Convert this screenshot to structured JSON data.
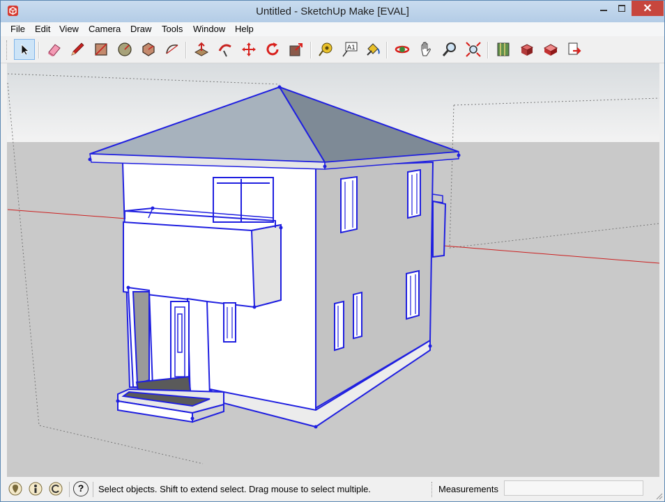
{
  "window": {
    "title": "Untitled - SketchUp Make [EVAL]",
    "close_symbol": "✕"
  },
  "menu": [
    "File",
    "Edit",
    "View",
    "Camera",
    "Draw",
    "Tools",
    "Window",
    "Help"
  ],
  "toolbar": {
    "tools": [
      "select-tool",
      "eraser-tool",
      "line-tool",
      "rectangle-tool",
      "circle-tool",
      "polygon-tool",
      "arc-tool",
      "push-pull-tool",
      "follow-me-tool",
      "move-tool",
      "rotate-tool",
      "scale-tool",
      "tape-measure-tool",
      "text-tool",
      "paint-bucket-tool",
      "orbit-tool",
      "pan-tool",
      "zoom-tool",
      "zoom-extents-tool",
      "model-info-tool",
      "components-tool",
      "warehouse-tool",
      "share-model-tool"
    ],
    "text_tool_label": "A1"
  },
  "status": {
    "message": "Select objects. Shift to extend select. Drag mouse to select multiple.",
    "measurements_label": "Measurements",
    "measurements_value": "",
    "help_symbol": "?"
  },
  "colors": {
    "sky": "#f2f2f2",
    "ground": "#c8c8c8",
    "selection_blue": "#1f1fe0",
    "x_axis": "#cc1f1f"
  }
}
